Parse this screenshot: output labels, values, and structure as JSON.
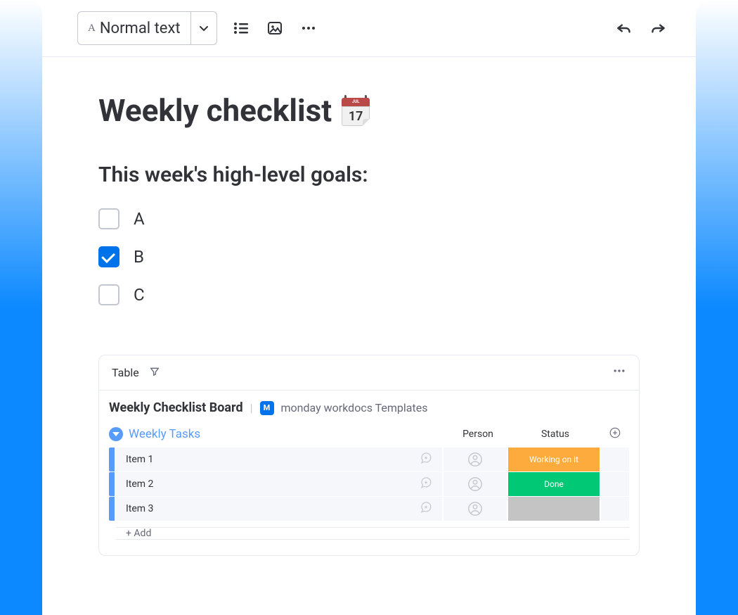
{
  "toolbar": {
    "textStyle": "Normal text"
  },
  "doc": {
    "title": "Weekly checklist",
    "calendarMonth": "JUL",
    "calendarDay": "17",
    "goalsHeading": "This week's high-level goals:",
    "goals": [
      {
        "label": "A",
        "checked": false
      },
      {
        "label": "B",
        "checked": true
      },
      {
        "label": "C",
        "checked": false
      }
    ]
  },
  "board": {
    "tab": "Table",
    "title": "Weekly Checklist Board",
    "workspaceBadge": "M",
    "workspaceName": "monday workdocs Templates",
    "groupName": "Weekly Tasks",
    "columns": {
      "person": "Person",
      "status": "Status"
    },
    "rows": [
      {
        "name": "Item 1",
        "status": "Working on it",
        "statusClass": "status-working"
      },
      {
        "name": "Item 2",
        "status": "Done",
        "statusClass": "status-done"
      },
      {
        "name": "Item 3",
        "status": "",
        "statusClass": "status-empty"
      }
    ],
    "addRow": "+ Add"
  }
}
